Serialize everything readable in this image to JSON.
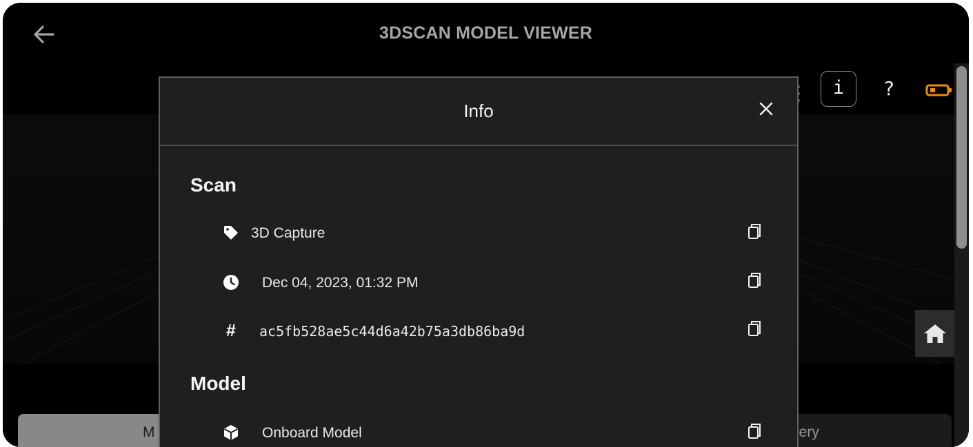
{
  "app": {
    "title": "3DSCAN MODEL VIEWER"
  },
  "toolbar": {
    "info_label": "i",
    "help_label": "?",
    "battery_color": "#f28b0c"
  },
  "bottom_tabs": {
    "left_label": "M",
    "right_label": "lery"
  },
  "icons": {
    "back": "arrow-left-icon",
    "more": "kebab-menu-icon",
    "battery": "battery-icon",
    "home": "home-icon",
    "close": "close-icon",
    "tag": "tag-icon",
    "clock": "clock-icon",
    "hash": "hash-icon",
    "cube": "cube-icon",
    "copy": "copy-icon"
  },
  "dialog": {
    "title": "Info",
    "sections": [
      {
        "title": "Scan",
        "rows": [
          {
            "icon": "tag-icon",
            "text": "3D Capture"
          },
          {
            "icon": "clock-icon",
            "text": "Dec 04, 2023, 01:32 PM"
          },
          {
            "icon": "hash-icon",
            "glyph": "#",
            "text": "ac5fb528ae5c44d6a42b75a3db86ba9d"
          }
        ]
      },
      {
        "title": "Model",
        "rows": [
          {
            "icon": "cube-icon",
            "text": "Onboard Model"
          }
        ]
      }
    ]
  }
}
